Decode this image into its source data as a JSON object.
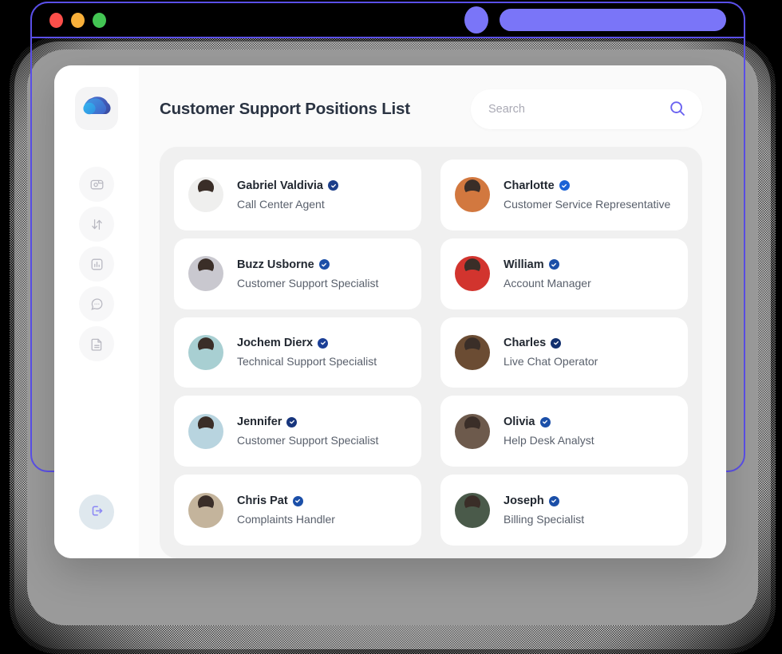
{
  "browser": {
    "traffic_lights": [
      "close-red",
      "minimize-yellow",
      "maximize-green"
    ],
    "url_pill_color": "#7a75f8",
    "chrome_background": "#000000",
    "outline_color": "#5a4fe8"
  },
  "sidebar": {
    "logo": {
      "name": "cloud-logo",
      "colors": [
        "#29a8e8",
        "#3d7de0",
        "#3f4fa8"
      ]
    },
    "items": [
      {
        "id": "wallet",
        "icon": "wallet-icon",
        "label": "Wallet"
      },
      {
        "id": "transfers",
        "icon": "transfer-arrows-icon",
        "label": "Transfers"
      },
      {
        "id": "reports",
        "icon": "bar-chart-icon",
        "label": "Reports"
      },
      {
        "id": "messages",
        "icon": "chat-bubble-icon",
        "label": "Messages"
      },
      {
        "id": "documents",
        "icon": "document-icon",
        "label": "Documents"
      }
    ],
    "logout": {
      "icon": "logout-icon",
      "label": "Log out",
      "accent": "#7a75f8",
      "background": "#dfe8ee"
    }
  },
  "header": {
    "title": "Customer Support Positions List"
  },
  "search": {
    "placeholder": "Search",
    "value": "",
    "icon": "search-icon",
    "icon_color": "#6a62f0"
  },
  "people": [
    {
      "name": "Gabriel Valdivia",
      "role": "Call Center Agent",
      "verified": true,
      "badge_color": "#1d3f8a",
      "avatar_tone": "#efefee"
    },
    {
      "name": "Charlotte",
      "role": "Customer Service Representative",
      "verified": true,
      "badge_color": "#1c63d6",
      "avatar_tone": "#d2783f"
    },
    {
      "name": "Buzz Usborne",
      "role": "Customer Support Specialist",
      "verified": true,
      "badge_color": "#1b4fa8",
      "avatar_tone": "#c9c8cf"
    },
    {
      "name": "William",
      "role": "Account Manager",
      "verified": true,
      "badge_color": "#1b4fa8",
      "avatar_tone": "#d2342e"
    },
    {
      "name": "Jochem Dierx",
      "role": "Technical Support Specialist",
      "verified": true,
      "badge_color": "#1b3f96",
      "avatar_tone": "#a8cfd2"
    },
    {
      "name": "Charles",
      "role": "Live Chat Operator",
      "verified": true,
      "badge_color": "#12306e",
      "avatar_tone": "#6b4c33"
    },
    {
      "name": "Jennifer",
      "role": "Customer Support Specialist",
      "verified": true,
      "badge_color": "#17357d",
      "avatar_tone": "#b8d4df"
    },
    {
      "name": "Olivia",
      "role": "Help Desk Analyst",
      "verified": true,
      "badge_color": "#1b4fa8",
      "avatar_tone": "#6d5a4c"
    },
    {
      "name": "Chris Pat",
      "role": "Complaints Handler",
      "verified": true,
      "badge_color": "#1b4fa8",
      "avatar_tone": "#c4b49c"
    },
    {
      "name": "Joseph",
      "role": "Billing Specialist",
      "verified": true,
      "badge_color": "#1b4fa8",
      "avatar_tone": "#4a5a4a"
    }
  ],
  "theme": {
    "page_background": "#fafafa",
    "panel_background": "#f0f0f0",
    "card_background": "#ffffff",
    "title_color": "#2a3342",
    "role_color": "#585f6b",
    "accent": "#7a75f8"
  }
}
